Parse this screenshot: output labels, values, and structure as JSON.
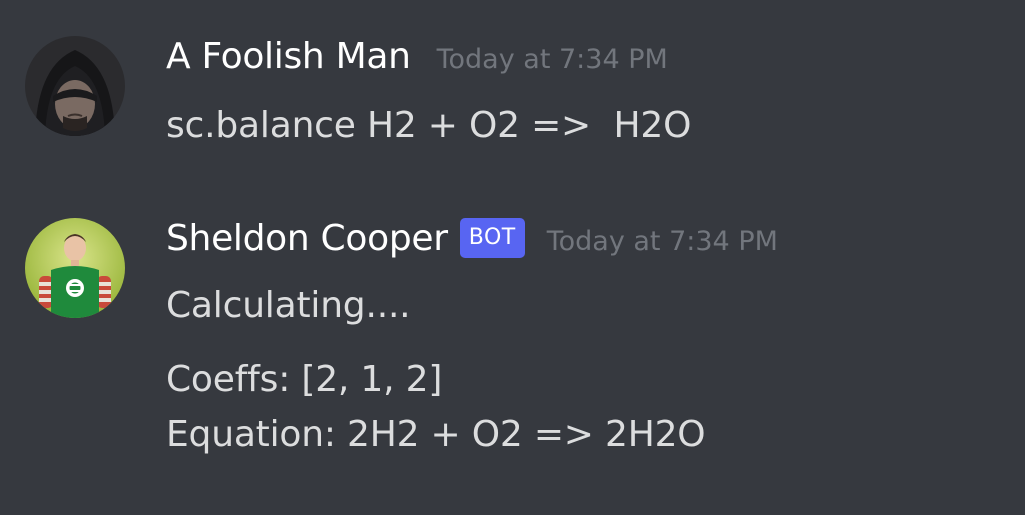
{
  "messages": [
    {
      "username": "A Foolish Man",
      "timestamp": "Today at 7:34 PM",
      "avatar_icon": "hooded-figure-avatar",
      "lines": [
        "sc.balance H2 + O2 =>  H2O"
      ]
    },
    {
      "username": "Sheldon Cooper",
      "badge": "BOT",
      "timestamp": "Today at 7:34 PM",
      "avatar_icon": "green-lantern-shirt-avatar",
      "lines": [
        "Calculating....",
        "Coeffs: [2, 1, 2]",
        "Equation: 2H2 + O2 => 2H2O"
      ]
    }
  ],
  "colors": {
    "background": "#36393f",
    "username": "#ffffff",
    "message_text": "#dcddde",
    "timestamp": "#72767d",
    "bot_badge": "#5865f2"
  }
}
